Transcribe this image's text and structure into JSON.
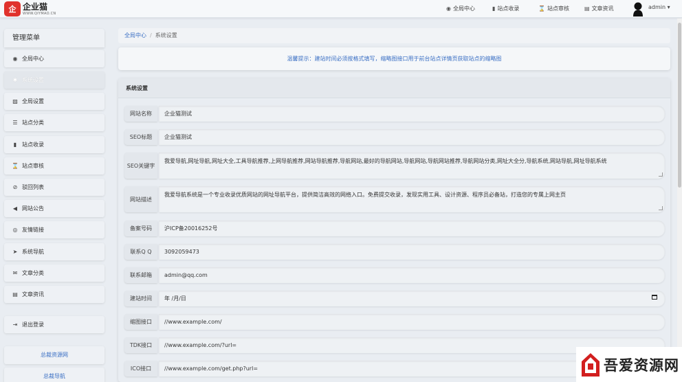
{
  "brand": {
    "logo_char": "企",
    "name": "企业猫",
    "domain": "WWW.QIYMAO.CN"
  },
  "topnav": [
    {
      "icon": "dashboard-icon",
      "glyph": "◉",
      "label": "全局中心"
    },
    {
      "icon": "book-icon",
      "glyph": "▮",
      "label": "站点收录"
    },
    {
      "icon": "hourglass-icon",
      "glyph": "⌛",
      "label": "站点审核"
    },
    {
      "icon": "news-icon",
      "glyph": "▤",
      "label": "文章资讯"
    }
  ],
  "user": {
    "name": "admin",
    "caret": "▾"
  },
  "sidebar": {
    "title": "管理菜单",
    "items": [
      {
        "icon": "dashboard-icon",
        "glyph": "◉",
        "label": "全局中心"
      },
      {
        "icon": "gear-icon",
        "glyph": "✱",
        "label": "系统设置"
      },
      {
        "icon": "image-icon",
        "glyph": "▨",
        "label": "全局设置"
      },
      {
        "icon": "sort-icon",
        "glyph": "☰",
        "label": "站点分类"
      },
      {
        "icon": "book-icon",
        "glyph": "▮",
        "label": "站点收录"
      },
      {
        "icon": "hourglass-icon",
        "glyph": "⌛",
        "label": "站点审核"
      },
      {
        "icon": "ban-icon",
        "glyph": "⊘",
        "label": "驳回列表"
      },
      {
        "icon": "bullhorn-icon",
        "glyph": "◀",
        "label": "网站公告"
      },
      {
        "icon": "handshake-icon",
        "glyph": "◎",
        "label": "友情链接"
      },
      {
        "icon": "send-icon",
        "glyph": "➤",
        "label": "系统导航"
      },
      {
        "icon": "envelope-icon",
        "glyph": "✉",
        "label": "文章分类"
      },
      {
        "icon": "newspaper-icon",
        "glyph": "▤",
        "label": "文章资讯"
      }
    ],
    "logout": {
      "icon": "sign-out-icon",
      "glyph": "⇥",
      "label": "退出登录"
    },
    "links": [
      "总裁资源网",
      "总裁导航"
    ]
  },
  "breadcrumb": {
    "home": "全局中心",
    "separator": "/",
    "current": "系统设置"
  },
  "tip": "温馨提示：建站时间必须按格式填写，缩略图接口用于前台站点详情页获取站点的缩略图",
  "panel_title": "系统设置",
  "form": {
    "site_name": {
      "label": "网站名称",
      "value": "企业猫测试"
    },
    "seo_title": {
      "label": "SEO标题",
      "value": "企业猫测试"
    },
    "seo_keywords": {
      "label": "SEO关键字",
      "value": "我爱导航,网址导航,网址大全,工具导航推荐,上网导航推荐,网站导航推荐,导航网站,最好的导航网站,导航网站,导航网站推荐,导航网站分类,网址大全分,导航系统,网站导航,网址导航系统"
    },
    "site_desc": {
      "label": "网站描述",
      "value": "我爱导航系统是一个专业收录优质网站的网址导航平台，提供简洁高效的网络入口。免费提交收录，发现实用工具、设计资源、程序员必备站，打造您的专属上网主页"
    },
    "icp": {
      "label": "备案号码",
      "value": "沪ICP备20016252号"
    },
    "qq": {
      "label": "联系Q Q",
      "value": "3092059473"
    },
    "email": {
      "label": "联系邮箱",
      "value": "admin@qq.com"
    },
    "build_date": {
      "label": "建站时间",
      "value": "年 /月/日"
    },
    "thumb_api": {
      "label": "缩图接口",
      "value": "//www.example.com/"
    },
    "tdk_api": {
      "label": "TDK接口",
      "value": "//www.example.com/?url="
    },
    "ico_api": {
      "label": "ICO接口",
      "value": "//www.example.com/get.php?url="
    }
  },
  "watermark": {
    "text": "吾爱资源网"
  }
}
